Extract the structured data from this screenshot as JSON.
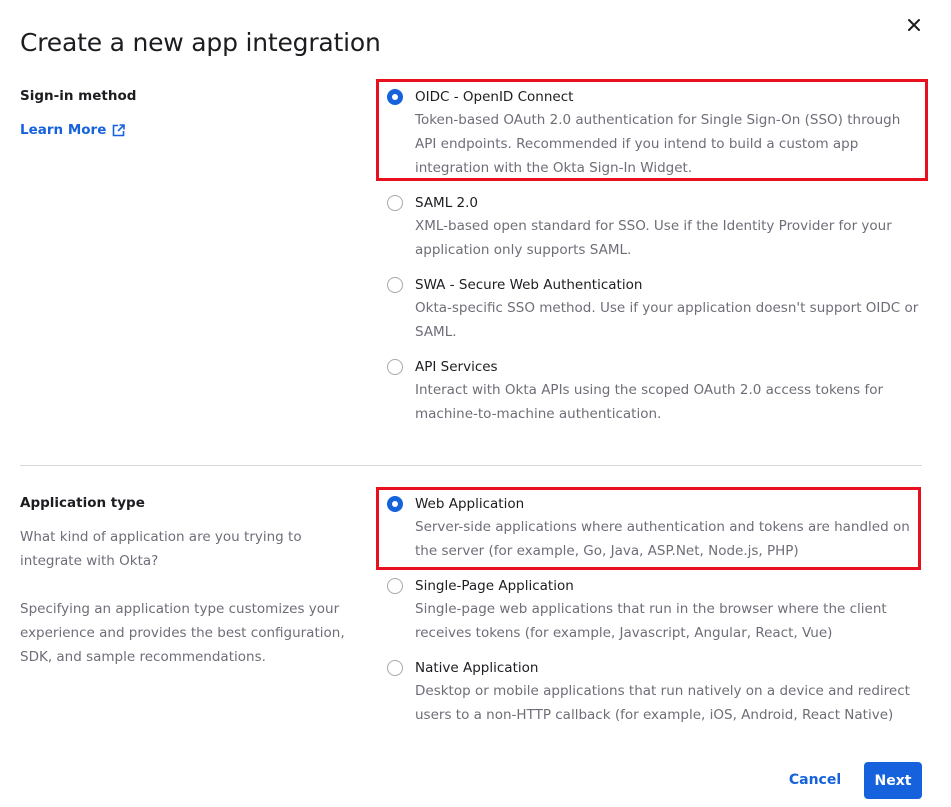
{
  "dialog": {
    "title": "Create a new app integration",
    "close_icon": "close-icon"
  },
  "sign_in": {
    "label": "Sign-in method",
    "learn_more": "Learn More",
    "learn_more_icon": "external-link-icon",
    "options": [
      {
        "label": "OIDC - OpenID Connect",
        "desc": "Token-based OAuth 2.0 authentication for Single Sign-On (SSO) through API endpoints. Recommended if you intend to build a custom app integration with the Okta Sign-In Widget.",
        "selected": true
      },
      {
        "label": "SAML 2.0",
        "desc": "XML-based open standard for SSO. Use if the Identity Provider for your application only supports SAML.",
        "selected": false
      },
      {
        "label": "SWA - Secure Web Authentication",
        "desc": "Okta-specific SSO method. Use if your application doesn't support OIDC or SAML.",
        "selected": false
      },
      {
        "label": "API Services",
        "desc": "Interact with Okta APIs using the scoped OAuth 2.0 access tokens for machine-to-machine authentication.",
        "selected": false
      }
    ]
  },
  "app_type": {
    "label": "Application type",
    "help1": "What kind of application are you trying to integrate with Okta?",
    "help2": "Specifying an application type customizes your experience and provides the best configuration, SDK, and sample recommendations.",
    "options": [
      {
        "label": "Web Application",
        "desc": "Server-side applications where authentication and tokens are handled on the server (for example, Go, Java, ASP.Net, Node.js, PHP)",
        "selected": true
      },
      {
        "label": "Single-Page Application",
        "desc": "Single-page web applications that run in the browser where the client receives tokens (for example, Javascript, Angular, React, Vue)",
        "selected": false
      },
      {
        "label": "Native Application",
        "desc": "Desktop or mobile applications that run natively on a device and redirect users to a non-HTTP callback (for example, iOS, Android, React Native)",
        "selected": false
      }
    ]
  },
  "footer": {
    "cancel": "Cancel",
    "next": "Next"
  },
  "colors": {
    "accent": "#1662dd",
    "highlight": "#e8101f",
    "muted_text": "#6e6e78"
  }
}
